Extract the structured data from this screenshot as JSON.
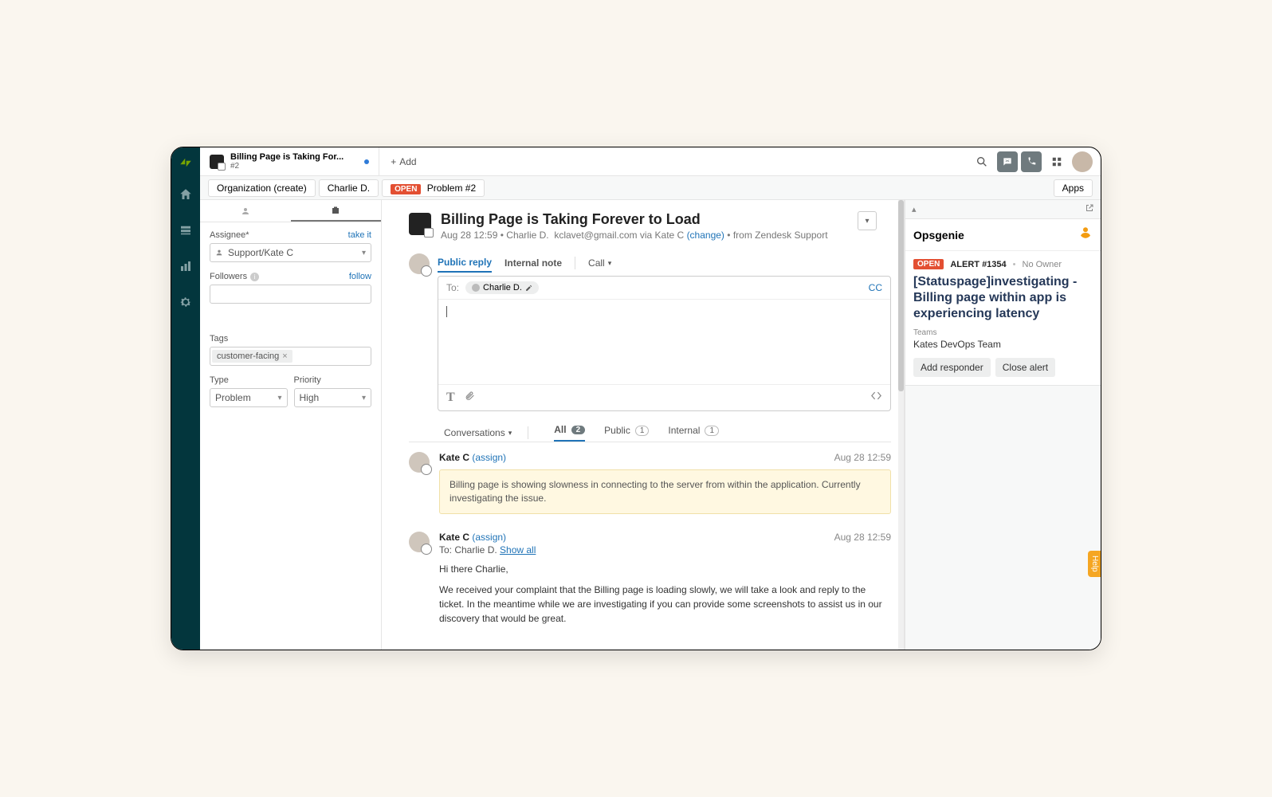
{
  "topbar": {
    "tab_title": "Billing Page is Taking For...",
    "tab_sub": "#2",
    "add_label": "Add"
  },
  "crumbs": {
    "org": "Organization (create)",
    "user": "Charlie D.",
    "open_label": "OPEN",
    "problem": "Problem #2",
    "apps_btn": "Apps"
  },
  "side": {
    "assignee_label": "Assignee*",
    "take_it": "take it",
    "assignee_value": "Support/Kate C",
    "followers_label": "Followers",
    "follow": "follow",
    "tags_label": "Tags",
    "tag": "customer-facing",
    "type_label": "Type",
    "type_value": "Problem",
    "priority_label": "Priority",
    "priority_value": "High"
  },
  "ticket": {
    "title": "Billing Page is Taking Forever to Load",
    "meta_time": "Aug 28 12:59",
    "meta_user": "Charlie D.",
    "meta_email": "kclavet@gmail.com via Kate C",
    "change": "(change)",
    "meta_source": "from Zendesk Support"
  },
  "composer": {
    "tab_public": "Public reply",
    "tab_internal": "Internal note",
    "tab_call": "Call",
    "to_label": "To:",
    "to_chip": "Charlie D.",
    "cc": "CC"
  },
  "conv": {
    "label": "Conversations",
    "tab_all": "All",
    "count_all": "2",
    "tab_public": "Public",
    "count_public": "1",
    "tab_internal": "Internal",
    "count_internal": "1"
  },
  "messages": [
    {
      "author": "Kate C",
      "assign": "(assign)",
      "ts": "Aug 28 12:59",
      "note": "Billing page is showing slowness in connecting to the server from within the application. Currently investigating the issue."
    },
    {
      "author": "Kate C",
      "assign": "(assign)",
      "ts": "Aug 28 12:59",
      "to_prefix": "To: Charlie D. ",
      "show_all": "Show all",
      "p1": "Hi there Charlie,",
      "p2": "We received your complaint that the Billing page is loading slowly, we will take a look and reply to the ticket. In the meantime while we are investigating if you can provide some screenshots to assist us in our discovery that would be great."
    }
  ],
  "opsgenie": {
    "name": "Opsgenie",
    "open": "OPEN",
    "alert_id": "ALERT #1354",
    "owner": "No Owner",
    "title": "[Statuspage]investigating - Billing page within app is experiencing latency",
    "teams_label": "Teams",
    "teams_value": "Kates DevOps Team",
    "add_responder": "Add responder",
    "close_alert": "Close alert"
  },
  "help": "Help"
}
